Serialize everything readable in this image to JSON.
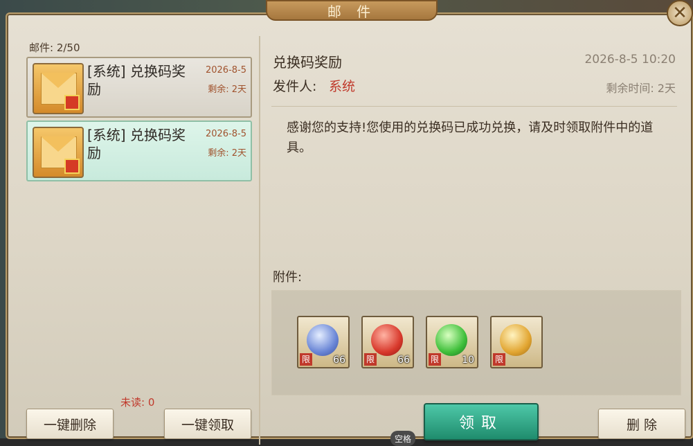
{
  "window": {
    "title": "邮 件",
    "close_icon": "close-icon"
  },
  "left": {
    "mail_count": "邮件: 2/50",
    "mails": [
      {
        "subject": "[系统] 兑换码奖励",
        "date": "2026-8-5",
        "expire": "剩余: 2天",
        "selected": false
      },
      {
        "subject": "[系统] 兑换码奖励",
        "date": "2026-8-5",
        "expire": "剩余: 2天",
        "selected": true
      }
    ],
    "unread": "未读: 0",
    "delete_all_label": "一键删除",
    "claim_all_label": "一键领取"
  },
  "detail": {
    "subject": "兑换码奖励",
    "date": "2026-8-5  10:20",
    "sender_label": "发件人:",
    "sender": "系统",
    "remaining": "剩余时间: 2天",
    "body": "感谢您的支持!您使用的兑换码已成功兑换，请及时领取附件中的道具。",
    "attachments_label": "附件:",
    "attachments": [
      {
        "icon": "blue-gem-icon",
        "limit_label": "限",
        "qty": "66"
      },
      {
        "icon": "red-gem-icon",
        "limit_label": "限",
        "qty": "66"
      },
      {
        "icon": "green-gem-icon",
        "limit_label": "限",
        "qty": "10"
      },
      {
        "icon": "gold-bag-icon",
        "limit_label": "限",
        "qty": ""
      }
    ],
    "claim_label": "领取",
    "delete_label": "删 除"
  },
  "hint": {
    "space_label": "空格"
  },
  "colors": {
    "accent_red": "#c0392b",
    "claim_green": "#1f8c6d",
    "frame_gold": "#b89c6a"
  }
}
